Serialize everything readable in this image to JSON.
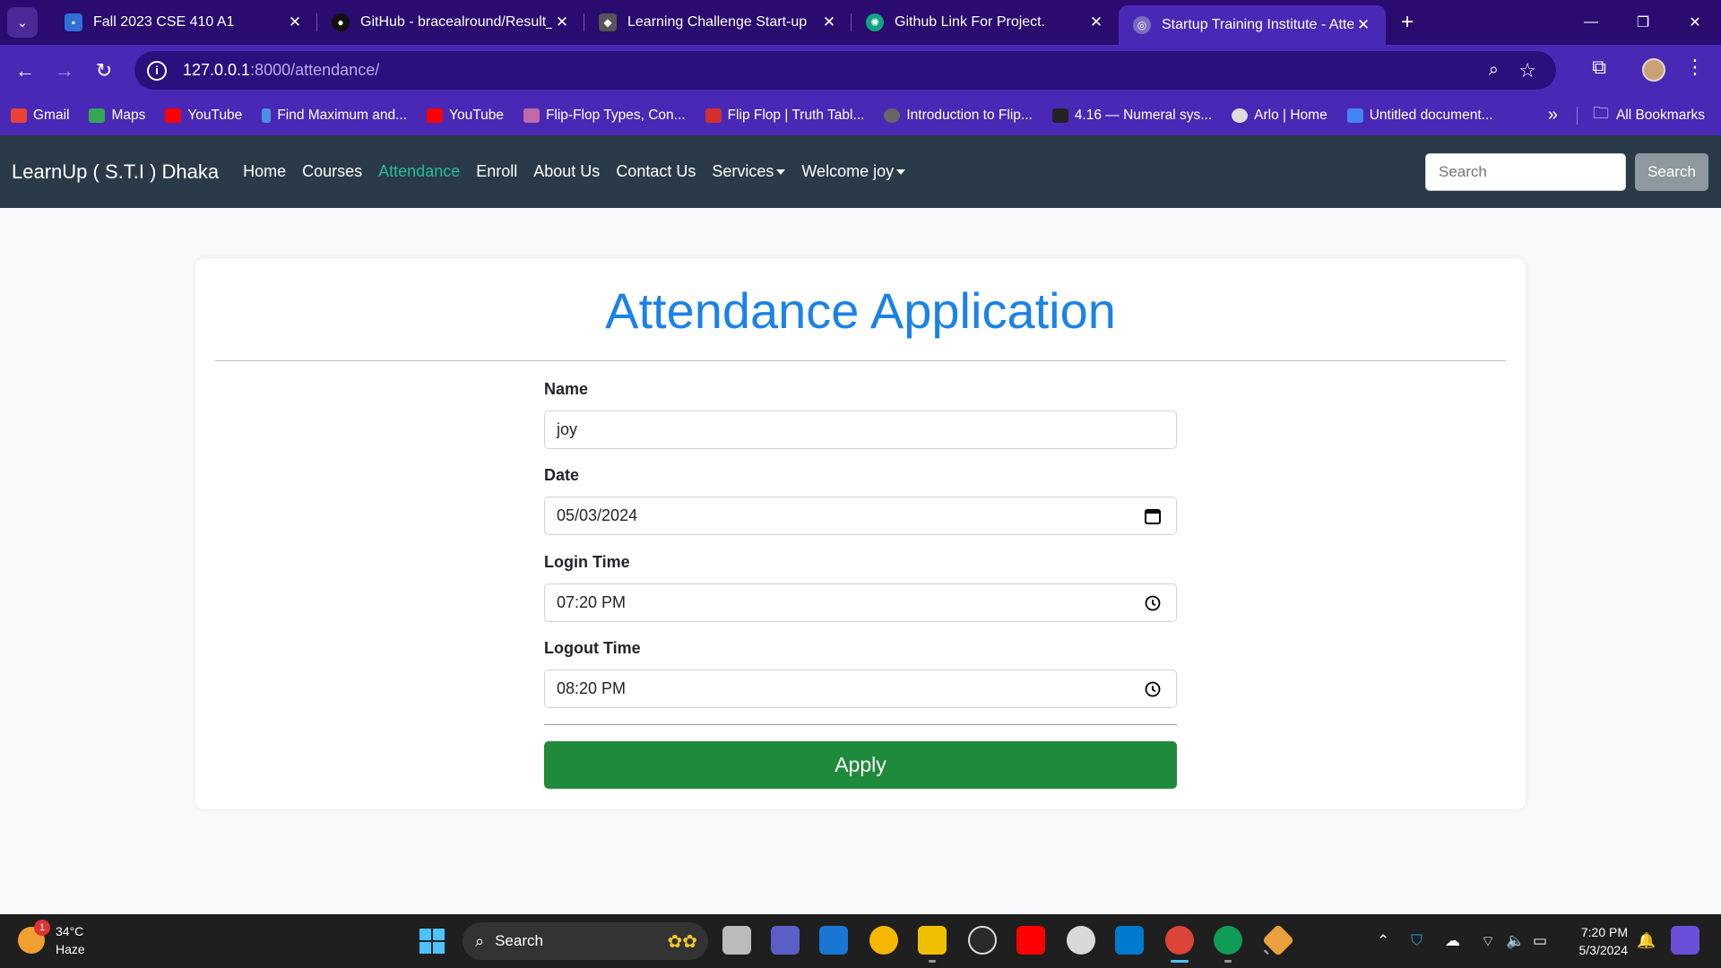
{
  "browser": {
    "tabs": [
      {
        "title": "Fall 2023 CSE 410 A1",
        "icon": "classroom-icon",
        "color": "#2f6fd6"
      },
      {
        "title": "GitHub - bracealround/Result_P",
        "icon": "github-icon",
        "color": "#111111"
      },
      {
        "title": "Learning Challenge Start-up",
        "icon": "site-icon",
        "color": "#333333"
      },
      {
        "title": "Github Link For Project.",
        "icon": "chatgpt-icon",
        "color": "#10a37f"
      },
      {
        "title": "Startup Training Institute - Atten",
        "icon": "globe-icon",
        "color": "#7a6cc0"
      }
    ],
    "new_tab": "+",
    "url_host": "127.0.0.1",
    "url_path": ":8000/attendance/",
    "bookmarks": [
      {
        "label": "Gmail",
        "color": "#ea4335"
      },
      {
        "label": "Maps",
        "color": "#34a853"
      },
      {
        "label": "YouTube",
        "color": "#ff0000"
      },
      {
        "label": "Find Maximum and...",
        "color": "#4a90e2"
      },
      {
        "label": "YouTube",
        "color": "#ff0000"
      },
      {
        "label": "Flip-Flop Types, Con...",
        "color": "#c06aa8"
      },
      {
        "label": "Flip Flop | Truth Tabl...",
        "color": "#d32f2f"
      },
      {
        "label": "Introduction to Flip...",
        "color": "#444444"
      },
      {
        "label": "4.16 — Numeral sys...",
        "color": "#222222"
      },
      {
        "label": "Arlo | Home",
        "color": "#dddddd"
      },
      {
        "label": "Untitled document...",
        "color": "#4285f4"
      }
    ],
    "all_bookmarks": "All Bookmarks"
  },
  "site": {
    "brand": "LearnUp ( S.T.I ) Dhaka",
    "nav": [
      "Home",
      "Courses",
      "Attendance",
      "Enroll",
      "About Us",
      "Contact Us",
      "Services",
      "Welcome joy"
    ],
    "search_placeholder": "Search",
    "search_button": "Search"
  },
  "form": {
    "title": "Attendance Application",
    "name_label": "Name",
    "name_value": "joy",
    "date_label": "Date",
    "date_value": "05/03/2024",
    "login_label": "Login Time",
    "login_value": "07:20 PM",
    "logout_label": "Logout Time",
    "logout_value": "08:20 PM",
    "apply_label": "Apply"
  },
  "taskbar": {
    "temperature": "34°C",
    "condition": "Haze",
    "weather_badge": "1",
    "search_label": "Search",
    "time": "7:20 PM",
    "date": "5/3/2024"
  },
  "colors": {
    "accent_link": "#1fbf95",
    "title_blue": "#1a82e8",
    "apply_green": "#1f8a3b",
    "navbar": "#2b3a48",
    "chrome_purple": "#4a28b6"
  }
}
